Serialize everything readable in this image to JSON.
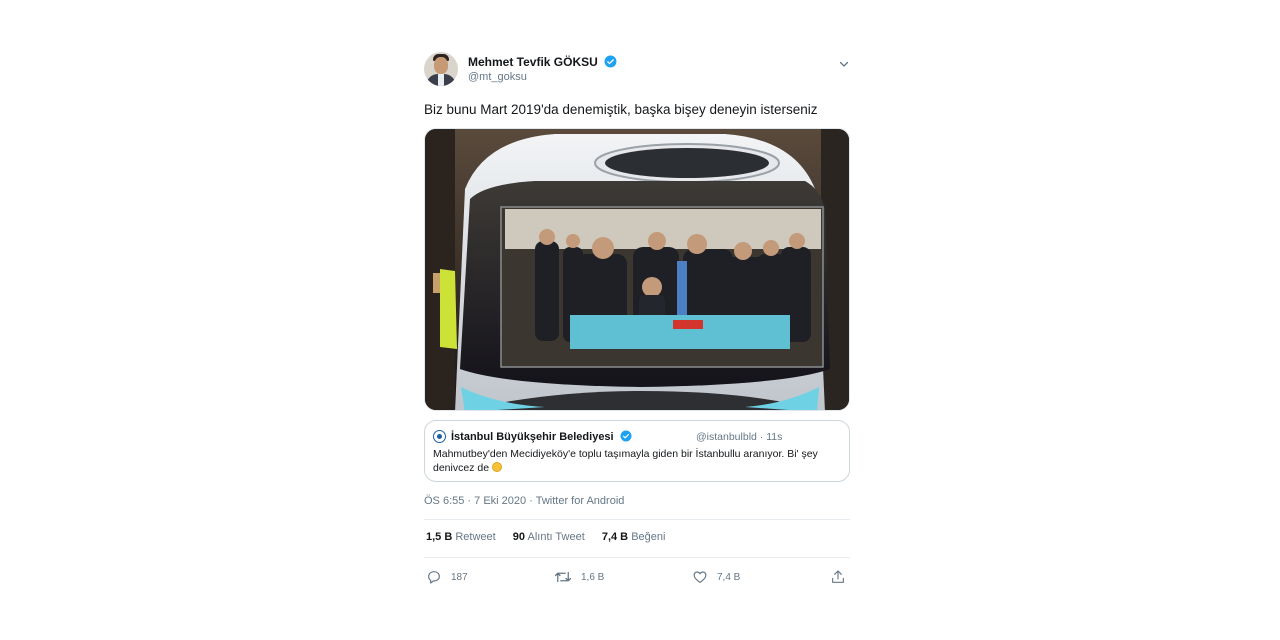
{
  "tweet": {
    "author_name": "Mehmet Tevfik GÖKSU",
    "author_handle": "@mt_goksu",
    "text": "Biz bunu Mart 2019'da denemiştik, başka bişey deneyin isterseniz",
    "quoted": {
      "name": "İstanbul Büyükşehir Belediyesi",
      "handle": "@istanbulbld",
      "separator": "·",
      "time": "11s",
      "text": "Mahmutbey'den Mecidiyeköy'e toplu taşımayla giden bir İstanbullu aranıyor. Bi' şey denivcez de"
    },
    "time": "ÖS 6:55",
    "date": "7 Eki 2020",
    "source": "Twitter for Android",
    "dot": "·",
    "stats": {
      "retweets_value": "1,5 B",
      "retweets_label": "Retweet",
      "quotes_value": "90",
      "quotes_label": "Alıntı Tweet",
      "likes_value": "7,4 B",
      "likes_label": "Beğeni"
    },
    "actions": {
      "reply_count": "187",
      "retweet_count": "1,6 B",
      "like_count": "7,4 B"
    }
  },
  "colors": {
    "verified": "#1da1f2",
    "muted": "#657786",
    "text": "#14171a",
    "border": "#ccd6dd"
  },
  "icons": [
    "verified-badge-icon",
    "chevron-down-icon",
    "reply-icon",
    "retweet-icon",
    "like-icon",
    "share-icon"
  ]
}
